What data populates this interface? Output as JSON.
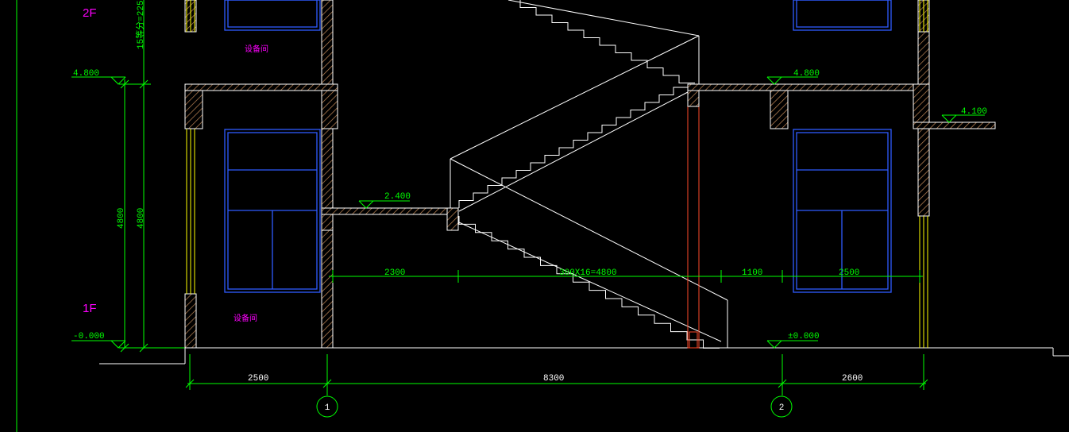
{
  "drawing": {
    "floor_labels": {
      "upper": "2F",
      "lower": "1F"
    },
    "left_dims": {
      "stair_note": "15等分=2250",
      "height_a": "4800",
      "height_b": "4800"
    },
    "elevations": {
      "left_level_2": "4.800",
      "left_level_0": "-0.000",
      "landing": "2.400",
      "right_level_2": "4.800",
      "right_level_canopy": "4.100",
      "right_level_0": "±0.000"
    },
    "room_labels": {
      "upper_left": "设备间",
      "lower_left": "设备间"
    },
    "interior_dims": [
      "2300",
      "300X16=4800",
      "1100",
      "2500"
    ],
    "bottom_dims": [
      "2500",
      "8300",
      "2600"
    ],
    "grid_axes": [
      "1",
      "2"
    ]
  },
  "colors": {
    "background": "#000000",
    "dimension": "#00ff00",
    "outline": "#ffffff",
    "window": "#2f5bff",
    "label": "#ff00ff",
    "glazing": "#ffff00",
    "column": "#ff4a2a"
  }
}
